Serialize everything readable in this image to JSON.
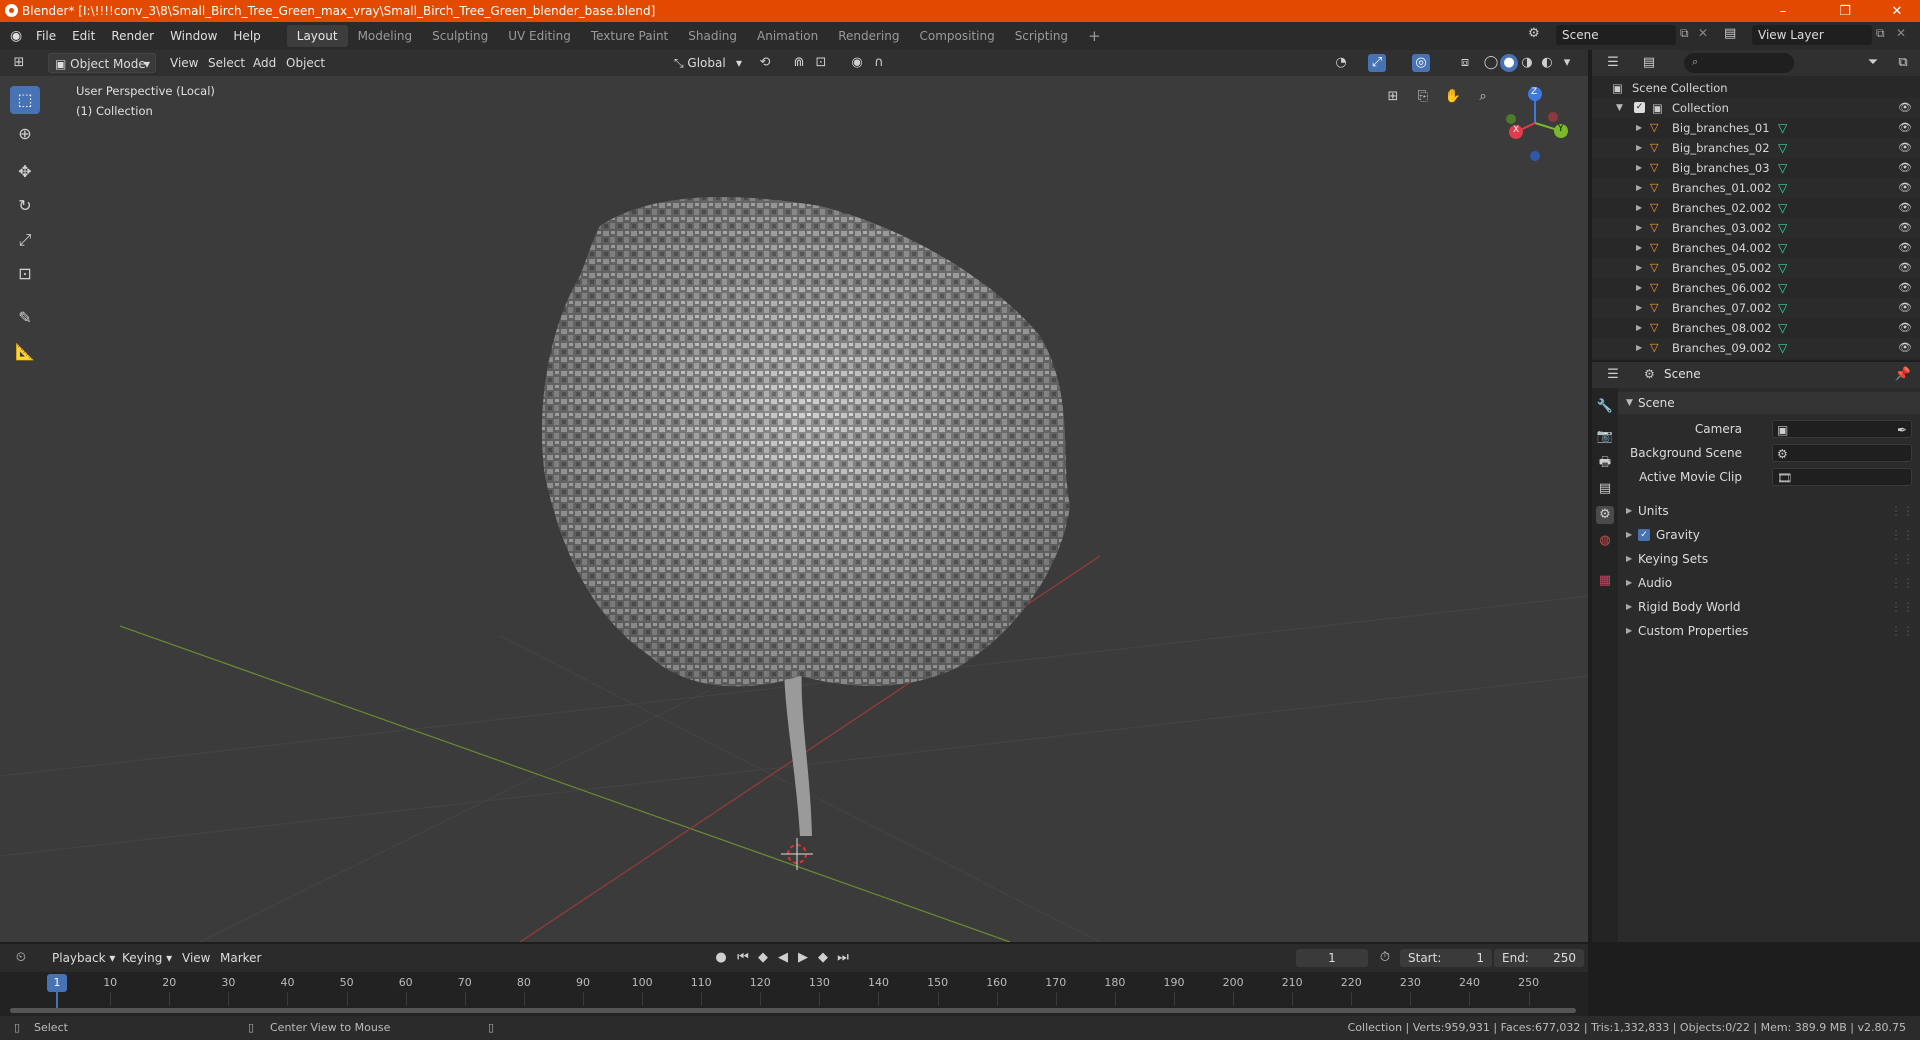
{
  "window": {
    "title": "Blender* [I:\\!!!!conv_3\\8\\Small_Birch_Tree_Green_max_vray\\Small_Birch_Tree_Green_blender_base.blend]",
    "minimize": "–",
    "maximize": "❐",
    "close": "✕"
  },
  "menus": [
    "File",
    "Edit",
    "Render",
    "Window",
    "Help"
  ],
  "workspaces": [
    "Layout",
    "Modeling",
    "Sculpting",
    "UV Editing",
    "Texture Paint",
    "Shading",
    "Animation",
    "Rendering",
    "Compositing",
    "Scripting"
  ],
  "workspace_add": "+",
  "scene_selector": "Scene",
  "view_layer_selector": "View Layer",
  "viewport_header": {
    "mode": "Object Mode",
    "menus": [
      "View",
      "Select",
      "Add",
      "Object"
    ],
    "orientation": "Global"
  },
  "viewport": {
    "perspective": "User Perspective (Local)",
    "collection": "(1) Collection",
    "gizmo": {
      "z": "Z",
      "y": "Y",
      "x": "X"
    }
  },
  "outliner": {
    "search_placeholder": "",
    "root": "Scene Collection",
    "collection": "Collection",
    "items": [
      "Big_branches_01",
      "Big_branches_02",
      "Big_branches_03",
      "Branches_01.002",
      "Branches_02.002",
      "Branches_03.002",
      "Branches_04.002",
      "Branches_05.002",
      "Branches_06.002",
      "Branches_07.002",
      "Branches_08.002",
      "Branches_09.002"
    ]
  },
  "properties": {
    "context": "Scene",
    "section": "Scene",
    "fields": [
      {
        "label": "Camera"
      },
      {
        "label": "Background Scene"
      },
      {
        "label": "Active Movie Clip"
      }
    ],
    "panels": [
      "Units",
      "Gravity",
      "Keying Sets",
      "Audio",
      "Rigid Body World",
      "Custom Properties"
    ],
    "gravity_checked": true
  },
  "timeline": {
    "menus": [
      "Playback",
      "Keying",
      "View",
      "Marker"
    ],
    "current_frame": "1",
    "start_label": "Start:",
    "start": "1",
    "end_label": "End:",
    "end": "250",
    "ticks": [
      "1",
      "10",
      "20",
      "30",
      "40",
      "50",
      "60",
      "70",
      "80",
      "90",
      "100",
      "110",
      "120",
      "130",
      "140",
      "150",
      "160",
      "170",
      "180",
      "190",
      "200",
      "210",
      "220",
      "230",
      "240",
      "250"
    ]
  },
  "status": {
    "left_action": "Select",
    "middle_action": "Center View to Mouse",
    "stats": "Collection | Verts:959,931 | Faces:677,032 | Tris:1,332,833 | Objects:0/22 | Mem: 389.9 MB | v2.80.75"
  },
  "colors": {
    "title_bar": "#e24a00",
    "accent": "#4772b3",
    "object_icon": "#ff9a2e",
    "mesh_icon": "#3fd3a6"
  }
}
